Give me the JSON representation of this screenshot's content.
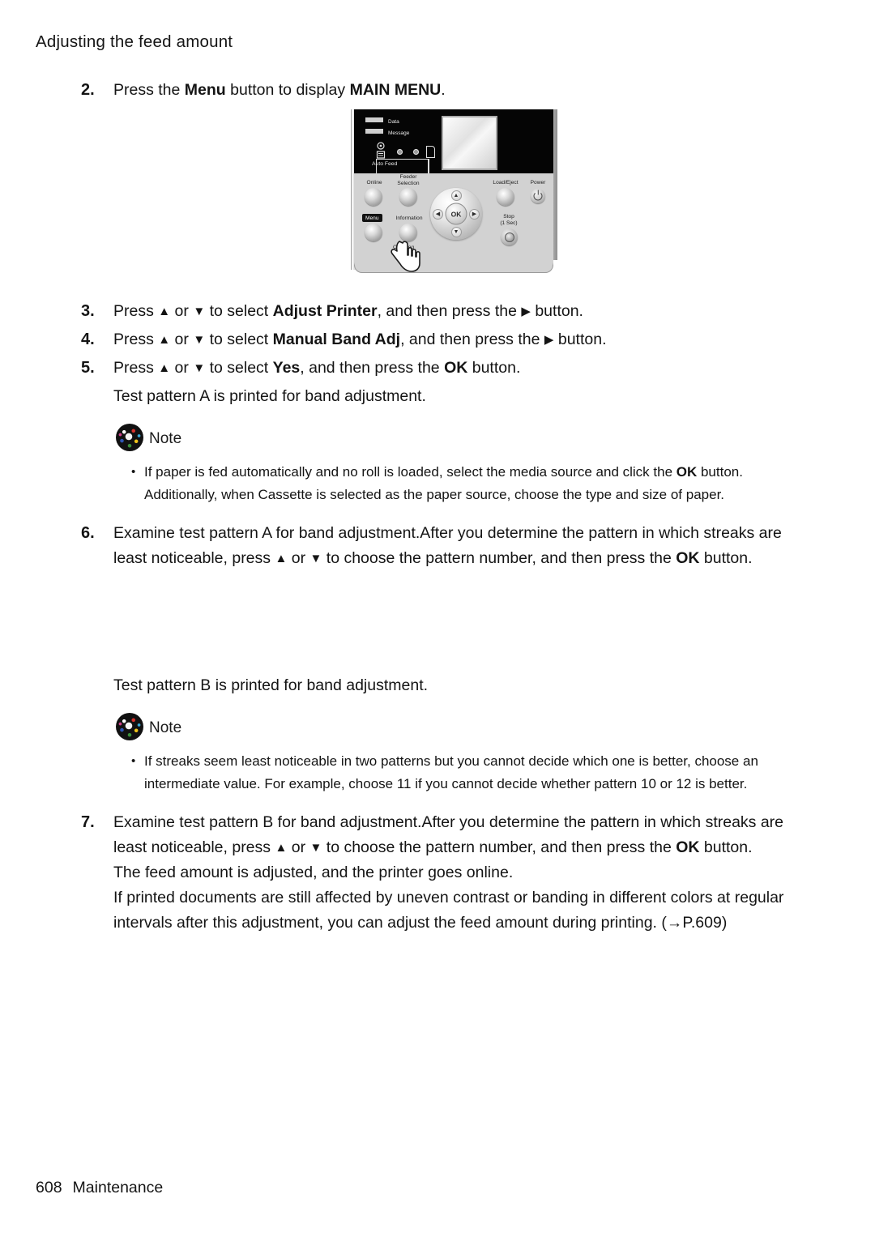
{
  "running_head": "Adjusting the feed amount",
  "steps": [
    {
      "number": "2.",
      "name": "step-2",
      "segments": [
        {
          "text": "Press the ",
          "bold": false
        },
        {
          "text": "Menu",
          "bold": true
        },
        {
          "text": " button to display ",
          "bold": false
        },
        {
          "text": "MAIN MENU",
          "bold": true
        },
        {
          "text": ".",
          "bold": false
        }
      ]
    },
    {
      "number": "3.",
      "name": "step-3",
      "segments": [
        {
          "text": "Press ",
          "bold": false
        },
        {
          "text": "▲",
          "bold": false
        },
        {
          "text": " or ",
          "bold": false
        },
        {
          "text": "▼",
          "bold": false
        },
        {
          "text": " to select ",
          "bold": false
        },
        {
          "text": "Adjust Printer",
          "bold": true
        },
        {
          "text": ", and then press the ",
          "bold": false
        },
        {
          "text": "▶",
          "bold": false
        },
        {
          "text": " button.",
          "bold": false
        }
      ]
    },
    {
      "number": "4.",
      "name": "step-4",
      "segments": [
        {
          "text": "Press ",
          "bold": false
        },
        {
          "text": "▲",
          "bold": false
        },
        {
          "text": " or ",
          "bold": false
        },
        {
          "text": "▼",
          "bold": false
        },
        {
          "text": " to select ",
          "bold": false
        },
        {
          "text": "Manual Band Adj",
          "bold": true
        },
        {
          "text": ", and then press the ",
          "bold": false
        },
        {
          "text": "▶",
          "bold": false
        },
        {
          "text": " button.",
          "bold": false
        }
      ]
    },
    {
      "number": "5.",
      "name": "step-5",
      "segments": [
        {
          "text": "Press ",
          "bold": false
        },
        {
          "text": "▲",
          "bold": false
        },
        {
          "text": " or ",
          "bold": false
        },
        {
          "text": "▼",
          "bold": false
        },
        {
          "text": " to select ",
          "bold": false
        },
        {
          "text": "Yes",
          "bold": true
        },
        {
          "text": ", and then press the ",
          "bold": false
        },
        {
          "text": "OK",
          "bold": true
        },
        {
          "text": " button.",
          "bold": false
        }
      ]
    }
  ],
  "after_step5": "Test pattern A is printed for band adjustment.",
  "note_a": {
    "icon_name": "note-icon",
    "label": "Note",
    "bullet_char": "•",
    "items": [
      [
        {
          "text": "If paper is fed automatically and no roll is loaded, select the media source and click the ",
          "bold": false
        },
        {
          "text": "OK",
          "bold": true
        },
        {
          "text": " button.",
          "bold": false
        }
      ],
      [
        {
          "text": "Additionally, when Cassette is selected as the paper source, choose the type and size of paper.",
          "bold": false
        }
      ]
    ]
  },
  "step6": {
    "number": "6.",
    "lines": [
      [
        {
          "text": "Examine test pattern A for band adjustment.After you determine the pattern in which streaks are",
          "bold": false
        }
      ],
      [
        {
          "text": "least noticeable, press ",
          "bold": false
        },
        {
          "text": "▲",
          "bold": false
        },
        {
          "text": " or ",
          "bold": false
        },
        {
          "text": "▼",
          "bold": false
        },
        {
          "text": " to choose the pattern number, and then press the ",
          "bold": false
        },
        {
          "text": "OK",
          "bold": true
        },
        {
          "text": " button.",
          "bold": false
        }
      ]
    ]
  },
  "after_step6": "Test pattern B is printed for band adjustment.",
  "note_b": {
    "icon_name": "note-icon",
    "label": "Note",
    "bullet_char": "•",
    "items": [
      [
        {
          "text": "If streaks seem least noticeable in two patterns but you cannot decide which one is better, choose an",
          "bold": false
        }
      ],
      [
        {
          "text": "intermediate value. For example, choose 11 if you cannot decide whether pattern 10 or 12 is better.",
          "bold": false
        }
      ]
    ]
  },
  "step7": {
    "number": "7.",
    "lines": [
      [
        {
          "text": "Examine test pattern B for band adjustment.After you determine the pattern in which streaks are",
          "bold": false
        }
      ],
      [
        {
          "text": "least noticeable, press ",
          "bold": false
        },
        {
          "text": "▲",
          "bold": false
        },
        {
          "text": " or ",
          "bold": false
        },
        {
          "text": "▼",
          "bold": false
        },
        {
          "text": " to choose the pattern number, and then press the ",
          "bold": false
        },
        {
          "text": "OK",
          "bold": true
        },
        {
          "text": " button.",
          "bold": false
        }
      ],
      [
        {
          "text": "The feed amount is adjusted, and the printer goes online.",
          "bold": false
        }
      ],
      [
        {
          "text": "If printed documents are still affected by uneven contrast or banding in different colors at regular",
          "bold": false
        }
      ],
      [
        {
          "text": "intervals after this adjustment, you can adjust the feed amount during printing. (→P.609)",
          "bold": false
        }
      ]
    ]
  },
  "footer": {
    "page_number": "608",
    "section": "Maintenance"
  },
  "panel": {
    "title": "printer-operation-panel",
    "leds": [
      {
        "label": "Data"
      },
      {
        "label": "Message"
      }
    ],
    "auto_feed_label": "Auto Feed",
    "buttons": [
      {
        "name": "online-button",
        "label": "Online"
      },
      {
        "name": "feeder-selection-button",
        "label": "Feeder\nSelection"
      },
      {
        "name": "menu-button",
        "label": "Menu"
      },
      {
        "name": "information-button",
        "label": "Information"
      },
      {
        "name": "cleaning-button",
        "label": "Cleaning\n(1 Sec)"
      },
      {
        "name": "load-eject-button",
        "label": "Load/Eject"
      },
      {
        "name": "power-button",
        "label": "Power"
      },
      {
        "name": "stop-button",
        "label": "Stop\n(1 Sec)"
      }
    ],
    "nav": {
      "ok_label": "OK",
      "up": "▲",
      "down": "▼",
      "left": "◀",
      "right": "▶"
    },
    "labels": {
      "online": "Online",
      "feeder_selection_1": "Feeder",
      "feeder_selection_2": "Selection",
      "menu": "Menu",
      "information": "Information",
      "cleaning_1": "Cleaning",
      "cleaning_2": "(1 Sec)",
      "load_eject": "Load/Eject",
      "power": "Power",
      "stop_1": "Stop",
      "stop_2": "(1 Sec)",
      "data": "Data",
      "message": "Message",
      "auto_feed": "Auto Feed"
    }
  }
}
